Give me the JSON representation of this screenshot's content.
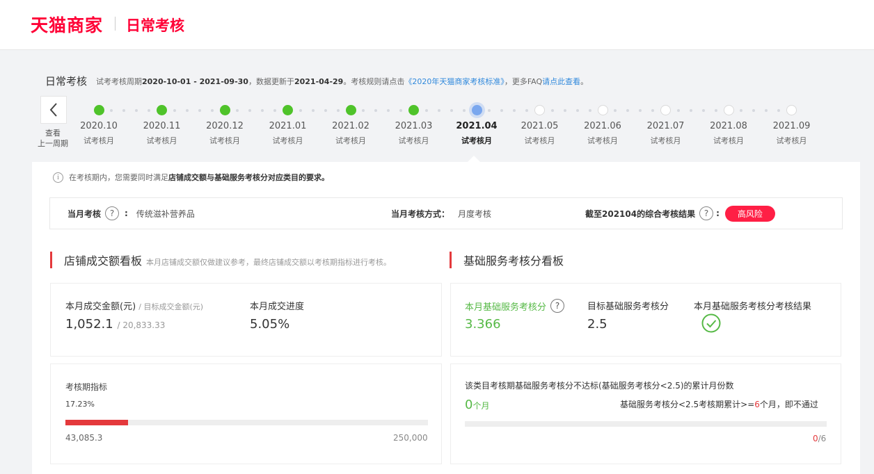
{
  "topbar": {
    "logo": "天猫商家",
    "title": "日常考核"
  },
  "header": {
    "title": "日常考核",
    "desc_prefix": "试考考核周期",
    "period": "2020-10-01 - 2021-09-30",
    "desc_mid": "，数据更新于",
    "update_date": "2021-04-29",
    "desc_rule": "。考核规则请点击",
    "rule_link": "《2020年天猫商家考核标准》",
    "desc_faq": "，更多FAQ",
    "faq_link": "请点此查看",
    "desc_end": "。"
  },
  "prev": {
    "label_line1": "查看",
    "label_line2": "上一周期"
  },
  "timeline": [
    {
      "month": "2020.10",
      "sub": "试考核月",
      "status": "done"
    },
    {
      "month": "2020.11",
      "sub": "试考核月",
      "status": "done"
    },
    {
      "month": "2020.12",
      "sub": "试考核月",
      "status": "done"
    },
    {
      "month": "2021.01",
      "sub": "试考核月",
      "status": "done"
    },
    {
      "month": "2021.02",
      "sub": "试考核月",
      "status": "done"
    },
    {
      "month": "2021.03",
      "sub": "试考核月",
      "status": "done"
    },
    {
      "month": "2021.04",
      "sub": "试考核月",
      "status": "current"
    },
    {
      "month": "2021.05",
      "sub": "试考核月",
      "status": "future"
    },
    {
      "month": "2021.06",
      "sub": "试考核月",
      "status": "future"
    },
    {
      "month": "2021.07",
      "sub": "试考核月",
      "status": "future"
    },
    {
      "month": "2021.08",
      "sub": "试考核月",
      "status": "future"
    },
    {
      "month": "2021.09",
      "sub": "试考核月",
      "status": "future"
    }
  ],
  "notice": {
    "pre": "在考核期内，您需要同时满足",
    "bold": "店铺成交额与基础服务考核分对应类目的要求。"
  },
  "summary": {
    "month_label": "当月考核",
    "category": "传统滋补营养品",
    "method_label": "当月考核方式：",
    "method": "月度考核",
    "result_label": "截至202104的综合考核结果",
    "result": "高风险"
  },
  "left_section": {
    "title": "店铺成交额看板",
    "note": "本月店铺成交额仅做建议参考，最终店铺成交额以考核期指标进行考核。",
    "amount_label": "本月成交金额(元)",
    "target_label": "/ 目标成交金额(元)",
    "amount": "1,052.1",
    "target": "20,833.33",
    "progress_label": "本月成交进度",
    "progress": "5.05%",
    "period_label": "考核期指标",
    "period_pct": "17.23%",
    "period_fraction": 0.1723,
    "period_current": "43,085.3",
    "period_target": "250,000"
  },
  "right_section": {
    "title": "基础服务考核分看板",
    "score_label": "本月基础服务考核分",
    "score": "3.366",
    "target_label": "目标基础服务考核分",
    "target": "2.5",
    "result_label": "本月基础服务考核分考核结果",
    "fail_desc": "该类目考核期基础服务考核分不达标(基础服务考核分<2.5)的累计月份数",
    "fail_count": "0",
    "fail_unit": "个月",
    "rule_text_pre": "基础服务考核分<2.5考核期累计>=",
    "rule_num": "6",
    "rule_text_post": "个月，即不通过",
    "fail_current": "0",
    "fail_total": "/6",
    "fail_fraction": 0
  },
  "colors": {
    "brand": "#ff0036",
    "done": "#4fc32a",
    "current": "#7aa7ee",
    "accent_red": "#e4393c",
    "good": "#56b946"
  }
}
